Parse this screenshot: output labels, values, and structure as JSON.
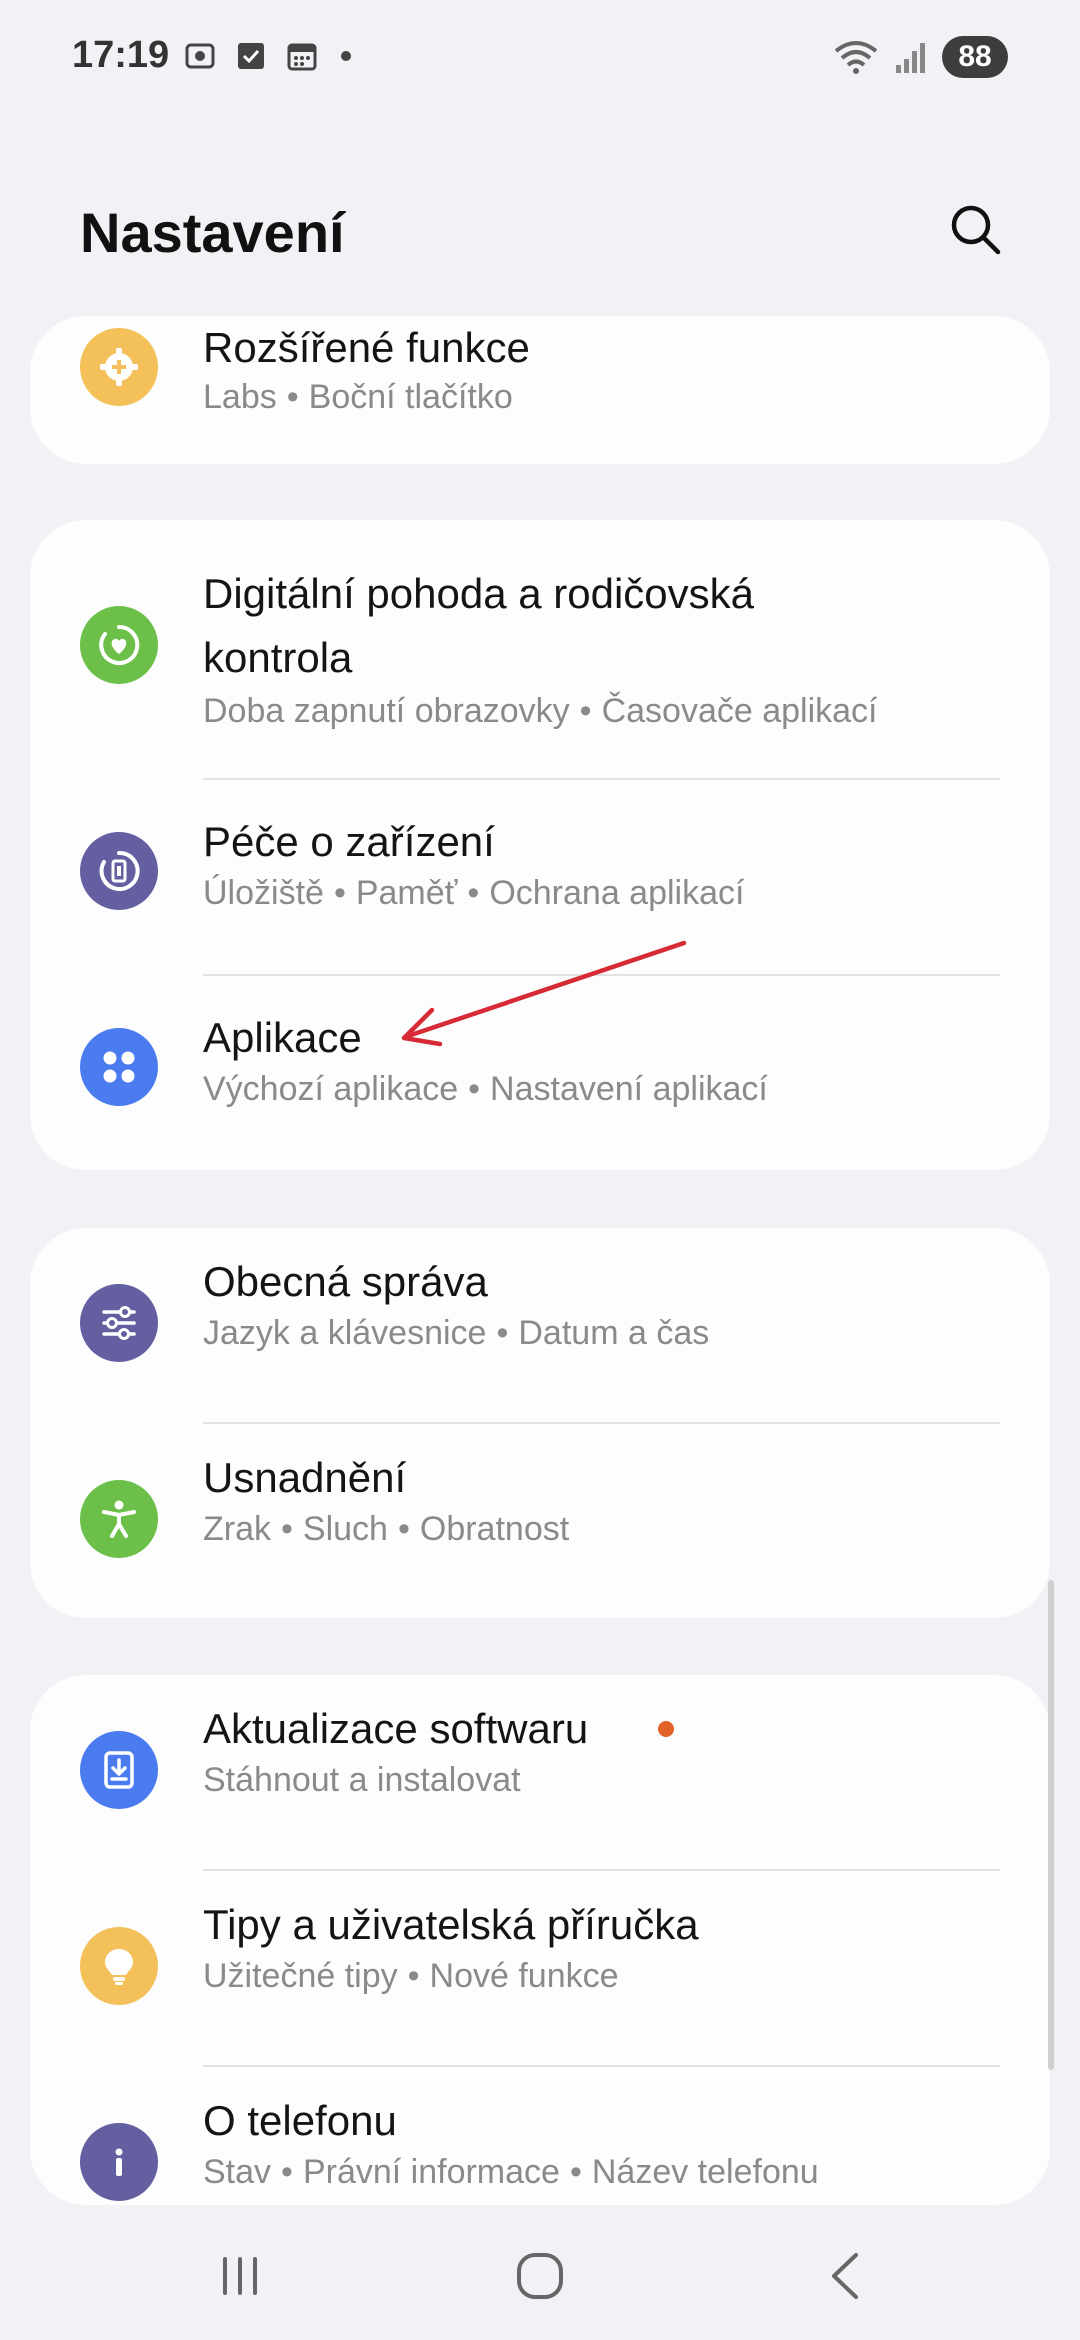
{
  "status": {
    "time": "17:19",
    "battery": "88"
  },
  "header": {
    "title": "Nastavení"
  },
  "groups": [
    {
      "items": [
        {
          "title": "Rozšířené funkce",
          "subtitle": [
            "Labs",
            "Boční tlačítko"
          ],
          "icon": "gear-plus-icon",
          "color": "#f4c05a"
        }
      ]
    },
    {
      "items": [
        {
          "title_lines": [
            "Digitální pohoda a rodičovská",
            "kontrola"
          ],
          "subtitle": [
            "Doba zapnutí obrazovky",
            "Časovače aplikací"
          ],
          "icon": "heart-circle-icon",
          "color": "#6cc04a"
        },
        {
          "title": "Péče o zařízení",
          "subtitle": [
            "Úložiště",
            "Paměť",
            "Ochrana aplikací"
          ],
          "icon": "device-care-icon",
          "color": "#645fa0"
        },
        {
          "title": "Aplikace",
          "subtitle": [
            "Výchozí aplikace",
            "Nastavení aplikací"
          ],
          "icon": "apps-grid-icon",
          "color": "#4a7cf0"
        }
      ]
    },
    {
      "items": [
        {
          "title": "Obecná správa",
          "subtitle": [
            "Jazyk a klávesnice",
            "Datum a čas"
          ],
          "icon": "sliders-icon",
          "color": "#645fa0"
        },
        {
          "title": "Usnadnění",
          "subtitle": [
            "Zrak",
            "Sluch",
            "Obratnost"
          ],
          "icon": "accessibility-icon",
          "color": "#6cc04a"
        }
      ]
    },
    {
      "items": [
        {
          "title": "Aktualizace softwaru",
          "subtitle": [
            "Stáhnout a instalovat"
          ],
          "icon": "download-icon",
          "color": "#4a7cf0"
        },
        {
          "title": "Tipy a uživatelská příručka",
          "subtitle": [
            "Užitečné tipy",
            "Nové funkce"
          ],
          "icon": "lightbulb-icon",
          "color": "#f4c05a"
        },
        {
          "title": "O telefonu",
          "subtitle": [
            "Stav",
            "Právní informace",
            "Název telefonu"
          ],
          "icon": "info-icon",
          "color": "#645fa0"
        }
      ]
    }
  ],
  "annotation_color": "#d62a36"
}
